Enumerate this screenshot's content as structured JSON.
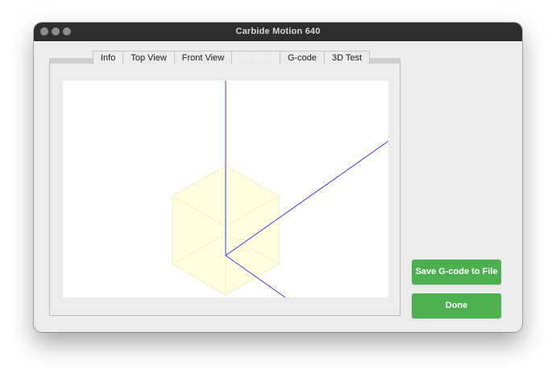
{
  "window": {
    "title": "Carbide Motion 640"
  },
  "tabs": [
    {
      "label": "Info",
      "active": false
    },
    {
      "label": "Top View",
      "active": false
    },
    {
      "label": "Front View",
      "active": false
    },
    {
      "label": "3D View",
      "active": true
    },
    {
      "label": "G-code",
      "active": false
    },
    {
      "label": "3D Test",
      "active": false
    }
  ],
  "buttons": {
    "save_label": "Save G-code to File",
    "done_label": "Done"
  },
  "colors": {
    "accent_green": "#4caf50",
    "axis_blue": "#3a3aff",
    "stock_fill": "#ffffe0",
    "stock_edge": "#eeeec0"
  }
}
